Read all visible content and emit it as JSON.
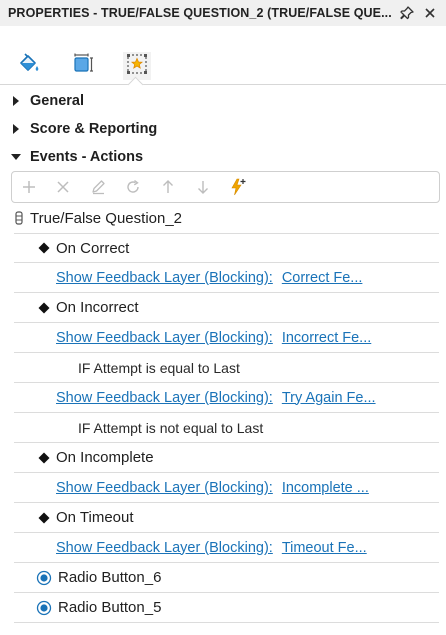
{
  "panel": {
    "title": "PROPERTIES - TRUE/FALSE QUESTION_2 (TRUE/FALSE QUE..."
  },
  "tabs": [
    {
      "icon": "paint-bucket-icon"
    },
    {
      "icon": "size-position-icon"
    },
    {
      "icon": "star-triggers-icon"
    }
  ],
  "sections": {
    "general": "General",
    "scoring": "Score & Reporting",
    "events": "Events - Actions"
  },
  "toolbar": {
    "icons": [
      "add-icon",
      "delete-icon",
      "edit-icon",
      "refresh-icon",
      "move-up-icon",
      "move-down-icon",
      "add-trigger-icon"
    ]
  },
  "tree": {
    "root": "True/False Question_2",
    "on_correct": "On Correct",
    "on_correct_action": "Show Feedback Layer (Blocking):",
    "on_correct_target": "Correct Fe...",
    "on_incorrect": "On Incorrect",
    "on_incorrect_action": "Show Feedback Layer (Blocking):",
    "on_incorrect_target": "Incorrect Fe...",
    "cond_equal": "IF Attempt is equal to Last",
    "cond_equal_action": "Show Feedback Layer (Blocking):",
    "cond_equal_target": "Try Again Fe...",
    "cond_not_equal": "IF Attempt is not equal to Last",
    "on_incomplete": "On Incomplete",
    "on_incomplete_action": "Show Feedback Layer (Blocking):",
    "on_incomplete_target": "Incomplete ...",
    "on_timeout": "On Timeout",
    "on_timeout_action": "Show Feedback Layer (Blocking):",
    "on_timeout_target": "Timeout Fe...",
    "radio_6": "Radio Button_6",
    "radio_5": "Radio Button_5"
  },
  "colors": {
    "accent": "#1a73b8",
    "trigger_icon": "#f0a500"
  }
}
